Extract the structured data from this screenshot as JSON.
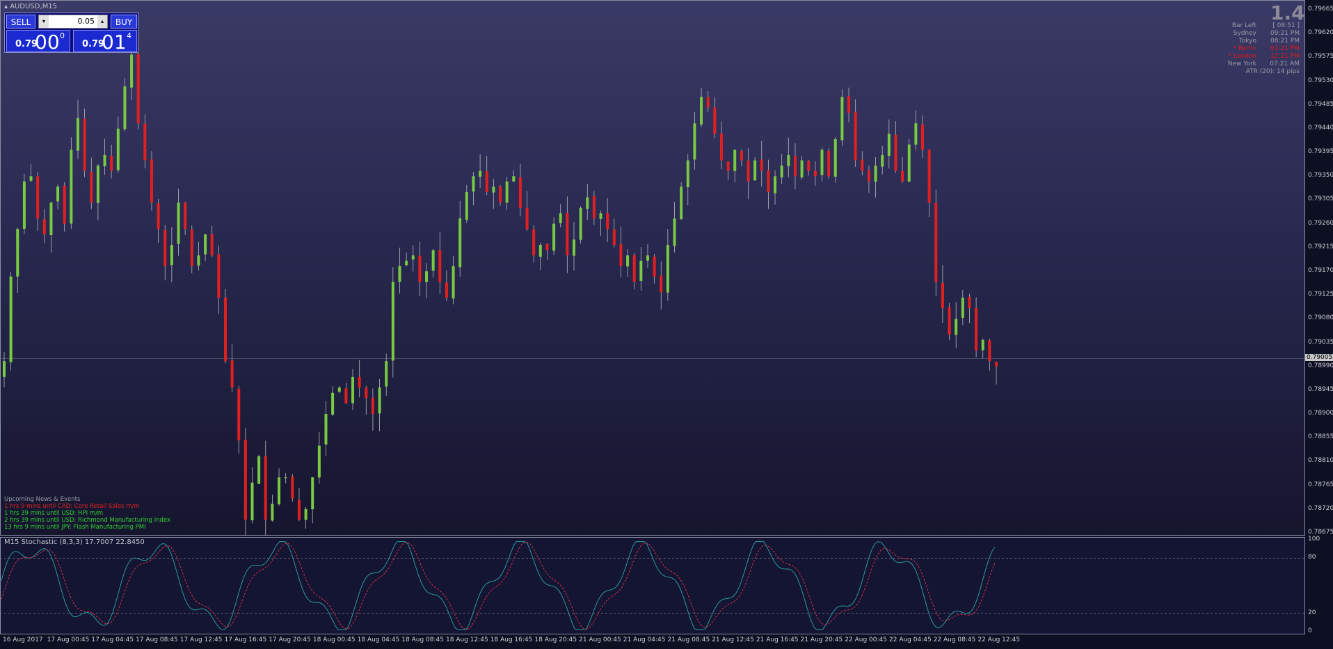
{
  "symbol_title": "AUDUSD,M15",
  "trade_panel": {
    "sell_label": "SELL",
    "buy_label": "BUY",
    "lot": "0.05",
    "bid_prefix": "0.79",
    "bid_big": "00",
    "bid_sup": "0",
    "ask_prefix": "0.79",
    "ask_big": "01",
    "ask_sup": "4"
  },
  "spread": "1.4",
  "sessions": [
    {
      "name": "Bar Left",
      "time": "[ 08:51 ]",
      "color": "#9a9aaa"
    },
    {
      "name": "Sydney",
      "time": "09:21 PM",
      "color": "#9a9aaa"
    },
    {
      "name": "Tokyo",
      "time": "08:21 PM",
      "color": "#9a9aaa"
    },
    {
      "name": "* Berlin",
      "time": "01:21 PM",
      "color": "#e01818"
    },
    {
      "name": "* London",
      "time": "12:21 PM",
      "color": "#e01818"
    },
    {
      "name": "New York",
      "time": "07:21 AM",
      "color": "#9a9aaa"
    }
  ],
  "atr_text": "ATR (20): 14 pips",
  "news": {
    "header": "Upcoming News & Events",
    "items": [
      {
        "text": "1 hrs 9 mins until CAD: Core Retail Sales m/m",
        "color": "#e02020"
      },
      {
        "text": "1 hrs 39 mins until USD: HPI m/m",
        "color": "#30d030"
      },
      {
        "text": "2 hrs 39 mins until USD: Richmond Manufacturing Index",
        "color": "#30d030"
      },
      {
        "text": "13 hrs 9 mins until JPY: Flash Manufacturing PMI",
        "color": "#30d030"
      }
    ]
  },
  "stoch_label": "M15 Stochastic (8,3,3) 17.7007 22.8450",
  "price_axis": [
    "0.79665",
    "0.79620",
    "0.79575",
    "0.79530",
    "0.79485",
    "0.79440",
    "0.79395",
    "0.79350",
    "0.79305",
    "0.79260",
    "0.79215",
    "0.79170",
    "0.79125",
    "0.79080",
    "0.79035",
    "0.78990",
    "0.78945",
    "0.78900",
    "0.78855",
    "0.78810",
    "0.78765",
    "0.78720",
    "0.78675"
  ],
  "current_price": "0.79005",
  "stoch_axis": [
    "100",
    "80",
    "20",
    "0"
  ],
  "time_axis": [
    "16 Aug 2017",
    "17 Aug 00:45",
    "17 Aug 04:45",
    "17 Aug 08:45",
    "17 Aug 12:45",
    "17 Aug 16:45",
    "17 Aug 20:45",
    "18 Aug 00:45",
    "18 Aug 04:45",
    "18 Aug 08:45",
    "18 Aug 12:45",
    "18 Aug 16:45",
    "18 Aug 20:45",
    "21 Aug 00:45",
    "21 Aug 04:45",
    "21 Aug 08:45",
    "21 Aug 12:45",
    "21 Aug 16:45",
    "21 Aug 20:45",
    "22 Aug 00:45",
    "22 Aug 04:45",
    "22 Aug 08:45",
    "22 Aug 12:45"
  ],
  "colors": {
    "bull": "#7ac943",
    "bear": "#e02020",
    "stoch_main": "#2a9a9a",
    "stoch_signal": "#d03050"
  },
  "chart_data": {
    "type": "candlestick",
    "ylim": [
      0.78675,
      0.79665
    ],
    "close_path": [
      0.79,
      0.7916,
      0.7925,
      0.7934,
      0.7935,
      0.7927,
      0.7924,
      0.793,
      0.7933,
      0.7926,
      0.794,
      0.7946,
      0.7936,
      0.793,
      0.7937,
      0.7939,
      0.7936,
      0.7944,
      0.7952,
      0.7958,
      0.7945,
      0.7938,
      0.793,
      0.7925,
      0.7918,
      0.7922,
      0.793,
      0.7925,
      0.7918,
      0.792,
      0.7924,
      0.792,
      0.7912,
      0.79,
      0.7895,
      0.7885,
      0.787,
      0.7877,
      0.7882,
      0.787,
      0.7873,
      0.7878,
      0.7878,
      0.7874,
      0.787,
      0.7872,
      0.7878,
      0.7884,
      0.789,
      0.7894,
      0.7895,
      0.7892,
      0.7897,
      0.7895,
      0.7893,
      0.789,
      0.7895,
      0.79,
      0.7915,
      0.7918,
      0.7919,
      0.792,
      0.7915,
      0.7917,
      0.7921,
      0.7915,
      0.7912,
      0.7918,
      0.7927,
      0.7932,
      0.7935,
      0.7936,
      0.7932,
      0.7933,
      0.793,
      0.7934,
      0.7935,
      0.7929,
      0.7925,
      0.792,
      0.7922,
      0.7921,
      0.7926,
      0.7928,
      0.792,
      0.7923,
      0.7929,
      0.7931,
      0.7927,
      0.7928,
      0.7925,
      0.7922,
      0.7918,
      0.792,
      0.7915,
      0.7919,
      0.792,
      0.7916,
      0.7913,
      0.7922,
      0.7927,
      0.7933,
      0.7938,
      0.7945,
      0.795,
      0.7948,
      0.7943,
      0.7938,
      0.7936,
      0.794,
      0.7938,
      0.7934,
      0.7938,
      0.7936,
      0.7932,
      0.7935,
      0.7937,
      0.7939,
      0.7935,
      0.7938,
      0.7936,
      0.7935,
      0.794,
      0.7935,
      0.7942,
      0.795,
      0.7947,
      0.7938,
      0.7936,
      0.7934,
      0.7937,
      0.7939,
      0.7943,
      0.7936,
      0.7934,
      0.7941,
      0.7945,
      0.794,
      0.793,
      0.7915,
      0.791,
      0.7905,
      0.7908,
      0.7912,
      0.791,
      0.7902,
      0.7904,
      0.79,
      0.7899
    ]
  }
}
